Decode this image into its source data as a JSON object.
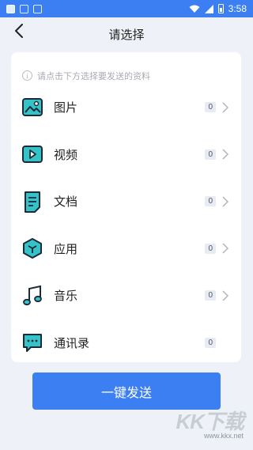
{
  "status_bar": {
    "time": "3:58"
  },
  "header": {
    "title": "请选择"
  },
  "hint": {
    "text": "请点击下方选择要发送的资料"
  },
  "items": [
    {
      "label": "图片",
      "count": "0",
      "icon": "image-icon",
      "chevron": true
    },
    {
      "label": "视频",
      "count": "0",
      "icon": "video-icon",
      "chevron": true
    },
    {
      "label": "文档",
      "count": "0",
      "icon": "document-icon",
      "chevron": true
    },
    {
      "label": "应用",
      "count": "0",
      "icon": "app-icon",
      "chevron": true
    },
    {
      "label": "音乐",
      "count": "0",
      "icon": "music-icon",
      "chevron": true
    },
    {
      "label": "通讯录",
      "count": "0",
      "icon": "contacts-icon",
      "chevron": false
    }
  ],
  "send_button": {
    "label": "一键发送"
  },
  "watermark": {
    "logo": "KK下载",
    "url": "www.kkx.net"
  },
  "colors": {
    "accent": "#3b7ff3",
    "icon_teal": "#35c3c8",
    "background": "#eef2f8"
  }
}
